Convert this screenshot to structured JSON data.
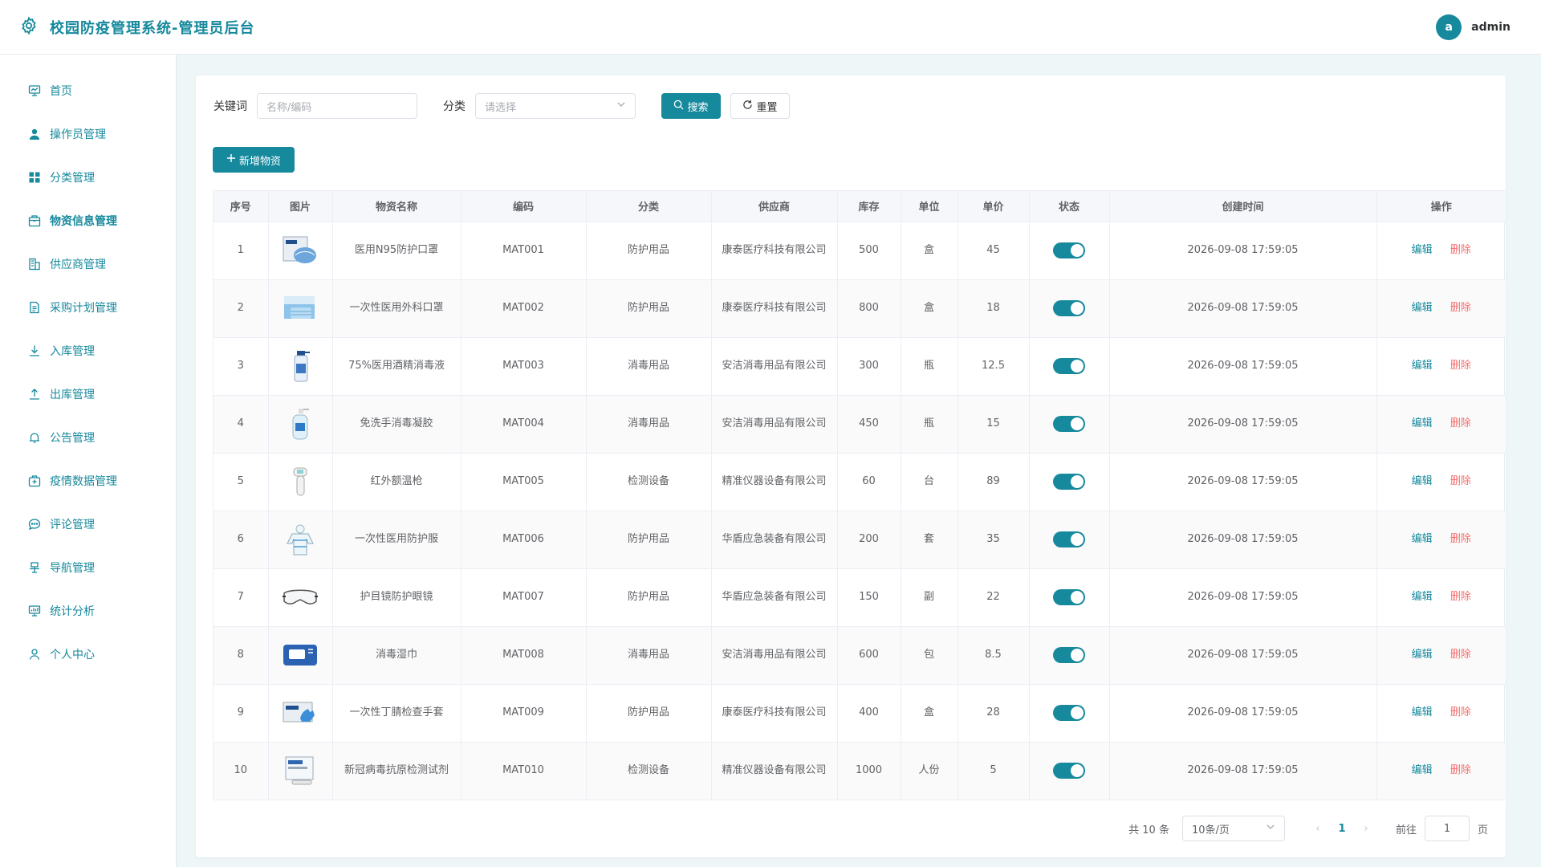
{
  "app": {
    "title": "校园防疫管理系统-管理员后台"
  },
  "user": {
    "avatar_letter": "a",
    "name": "admin"
  },
  "sidebar": {
    "items": [
      {
        "label": "首页",
        "icon": "dashboard-icon"
      },
      {
        "label": "操作员管理",
        "icon": "user-icon"
      },
      {
        "label": "分类管理",
        "icon": "grid-icon"
      },
      {
        "label": "物资信息管理",
        "icon": "package-icon",
        "active": true
      },
      {
        "label": "供应商管理",
        "icon": "building-icon"
      },
      {
        "label": "采购计划管理",
        "icon": "document-icon"
      },
      {
        "label": "入库管理",
        "icon": "download-icon"
      },
      {
        "label": "出库管理",
        "icon": "upload-icon"
      },
      {
        "label": "公告管理",
        "icon": "bell-icon"
      },
      {
        "label": "疫情数据管理",
        "icon": "medical-box-icon"
      },
      {
        "label": "评论管理",
        "icon": "chat-icon"
      },
      {
        "label": "导航管理",
        "icon": "guide-icon"
      },
      {
        "label": "统计分析",
        "icon": "chart-icon"
      },
      {
        "label": "个人中心",
        "icon": "person-icon"
      }
    ]
  },
  "search": {
    "keyword_label": "关键词",
    "keyword_placeholder": "名称/编码",
    "category_label": "分类",
    "category_placeholder": "请选择",
    "search_button": "搜索",
    "reset_button": "重置"
  },
  "toolbar": {
    "add_button": "新增物资"
  },
  "table": {
    "columns": [
      "序号",
      "图片",
      "物资名称",
      "编码",
      "分类",
      "供应商",
      "库存",
      "单位",
      "单价",
      "状态",
      "创建时间",
      "操作"
    ],
    "edit_label": "编辑",
    "delete_label": "删除",
    "rows": [
      {
        "index": "1",
        "image": "n95-mask-box",
        "name": "医用N95防护口罩",
        "code": "MAT001",
        "category": "防护用品",
        "supplier": "康泰医疗科技有限公司",
        "stock": "500",
        "unit": "盒",
        "price": "45",
        "status_on": true,
        "created": "2026-09-08 17:59:05"
      },
      {
        "index": "2",
        "image": "surgical-mask-box",
        "name": "一次性医用外科口罩",
        "code": "MAT002",
        "category": "防护用品",
        "supplier": "康泰医疗科技有限公司",
        "stock": "800",
        "unit": "盒",
        "price": "18",
        "status_on": true,
        "created": "2026-09-08 17:59:05"
      },
      {
        "index": "3",
        "image": "spray-bottle",
        "name": "75%医用酒精消毒液",
        "code": "MAT003",
        "category": "消毒用品",
        "supplier": "安洁消毒用品有限公司",
        "stock": "300",
        "unit": "瓶",
        "price": "12.5",
        "status_on": true,
        "created": "2026-09-08 17:59:05"
      },
      {
        "index": "4",
        "image": "pump-bottle",
        "name": "免洗手消毒凝胶",
        "code": "MAT004",
        "category": "消毒用品",
        "supplier": "安洁消毒用品有限公司",
        "stock": "450",
        "unit": "瓶",
        "price": "15",
        "status_on": true,
        "created": "2026-09-08 17:59:05"
      },
      {
        "index": "5",
        "image": "thermometer-gun",
        "name": "红外额温枪",
        "code": "MAT005",
        "category": "检测设备",
        "supplier": "精准仪器设备有限公司",
        "stock": "60",
        "unit": "台",
        "price": "89",
        "status_on": true,
        "created": "2026-09-08 17:59:05"
      },
      {
        "index": "6",
        "image": "protective-suit",
        "name": "一次性医用防护服",
        "code": "MAT006",
        "category": "防护用品",
        "supplier": "华盾应急装备有限公司",
        "stock": "200",
        "unit": "套",
        "price": "35",
        "status_on": true,
        "created": "2026-09-08 17:59:05"
      },
      {
        "index": "7",
        "image": "goggles",
        "name": "护目镜防护眼镜",
        "code": "MAT007",
        "category": "防护用品",
        "supplier": "华盾应急装备有限公司",
        "stock": "150",
        "unit": "副",
        "price": "22",
        "status_on": true,
        "created": "2026-09-08 17:59:05"
      },
      {
        "index": "8",
        "image": "wipes-pack",
        "name": "消毒湿巾",
        "code": "MAT008",
        "category": "消毒用品",
        "supplier": "安洁消毒用品有限公司",
        "stock": "600",
        "unit": "包",
        "price": "8.5",
        "status_on": true,
        "created": "2026-09-08 17:59:05"
      },
      {
        "index": "9",
        "image": "glove-box",
        "name": "一次性丁腈检查手套",
        "code": "MAT009",
        "category": "防护用品",
        "supplier": "康泰医疗科技有限公司",
        "stock": "400",
        "unit": "盒",
        "price": "28",
        "status_on": true,
        "created": "2026-09-08 17:59:05"
      },
      {
        "index": "10",
        "image": "test-kit",
        "name": "新冠病毒抗原检测试剂",
        "code": "MAT010",
        "category": "检测设备",
        "supplier": "精准仪器设备有限公司",
        "stock": "1000",
        "unit": "人份",
        "price": "5",
        "status_on": true,
        "created": "2026-09-08 17:59:05"
      }
    ]
  },
  "pagination": {
    "total_text": "共 10 条",
    "page_size": "10条/页",
    "current_page": "1",
    "goto_label": "前往",
    "goto_value": "1",
    "page_suffix": "页"
  },
  "colors": {
    "primary": "#16899d",
    "danger": "#f56c6c"
  }
}
